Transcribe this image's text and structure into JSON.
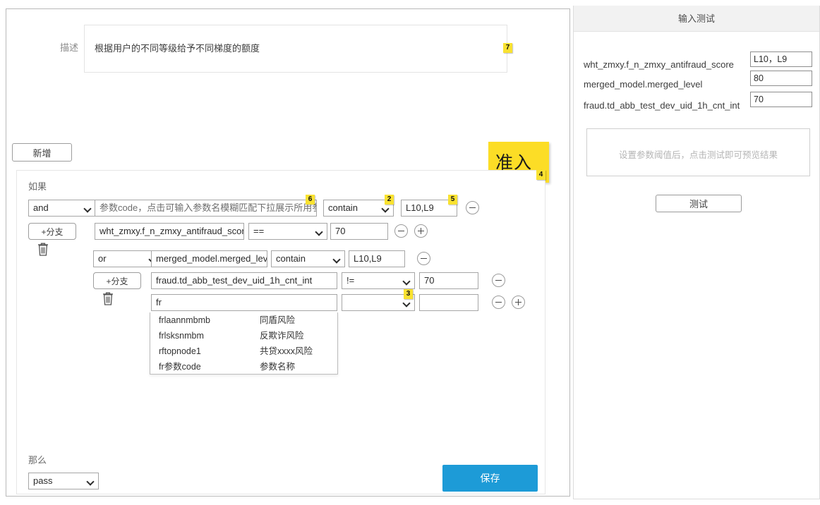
{
  "left": {
    "description": {
      "label": "描述",
      "value": "根据用户的不同等级给予不同梯度的额度"
    },
    "add_button": "新增",
    "annotation_block": {
      "text": "准入",
      "badge": "4",
      "color": "#fcdd26"
    },
    "badges": {
      "desc": "7",
      "param_field": "6",
      "operator": "2",
      "value_field": "5",
      "empty_operator": "3"
    },
    "rule": {
      "if_label": "如果",
      "then_label": "那么",
      "branch_button": "+分支",
      "rows": [
        {
          "logic": "and",
          "param": "参数code，点击可输入参数名模糊匹配下拉展示所用参数",
          "param_is_placeholder": true,
          "operator": "contain",
          "value": "L10,L9"
        },
        {
          "logic": "",
          "param": "wht_zmxy.f_n_zmxy_antifraud_score",
          "param_is_placeholder": false,
          "operator": "==",
          "value": "70"
        },
        {
          "logic": "or",
          "param": "merged_model.merged_level",
          "param_is_placeholder": false,
          "operator": "contain",
          "value": "L10,L9"
        },
        {
          "logic": "",
          "param": "fraud.td_abb_test_dev_uid_1h_cnt_int",
          "param_is_placeholder": false,
          "operator": "!=",
          "value": "70"
        },
        {
          "logic": "",
          "param": "fr",
          "param_is_placeholder": false,
          "operator": "",
          "value": ""
        }
      ],
      "suggestions": [
        {
          "code": "frlaannmbmb",
          "name": "同盾风险"
        },
        {
          "code": "frlsksnmbm",
          "name": "反欺诈风险"
        },
        {
          "code": "rftopnode1",
          "name": "共贷xxxx风险"
        },
        {
          "code": "fr参数code",
          "name": "参数名称"
        }
      ],
      "then_value": "pass",
      "save_button": "保存"
    }
  },
  "right": {
    "title": "输入测试",
    "params": [
      {
        "label": "wht_zmxy.f_n_zmxy_antifraud_score",
        "value": "L10，L9"
      },
      {
        "label": "merged_model.merged_level",
        "value": "80"
      },
      {
        "label": "fraud.td_abb_test_dev_uid_1h_cnt_int",
        "value": "70"
      }
    ],
    "result_hint": "设置参数阈值后，点击测试即可预览结果",
    "test_button": "测试"
  }
}
